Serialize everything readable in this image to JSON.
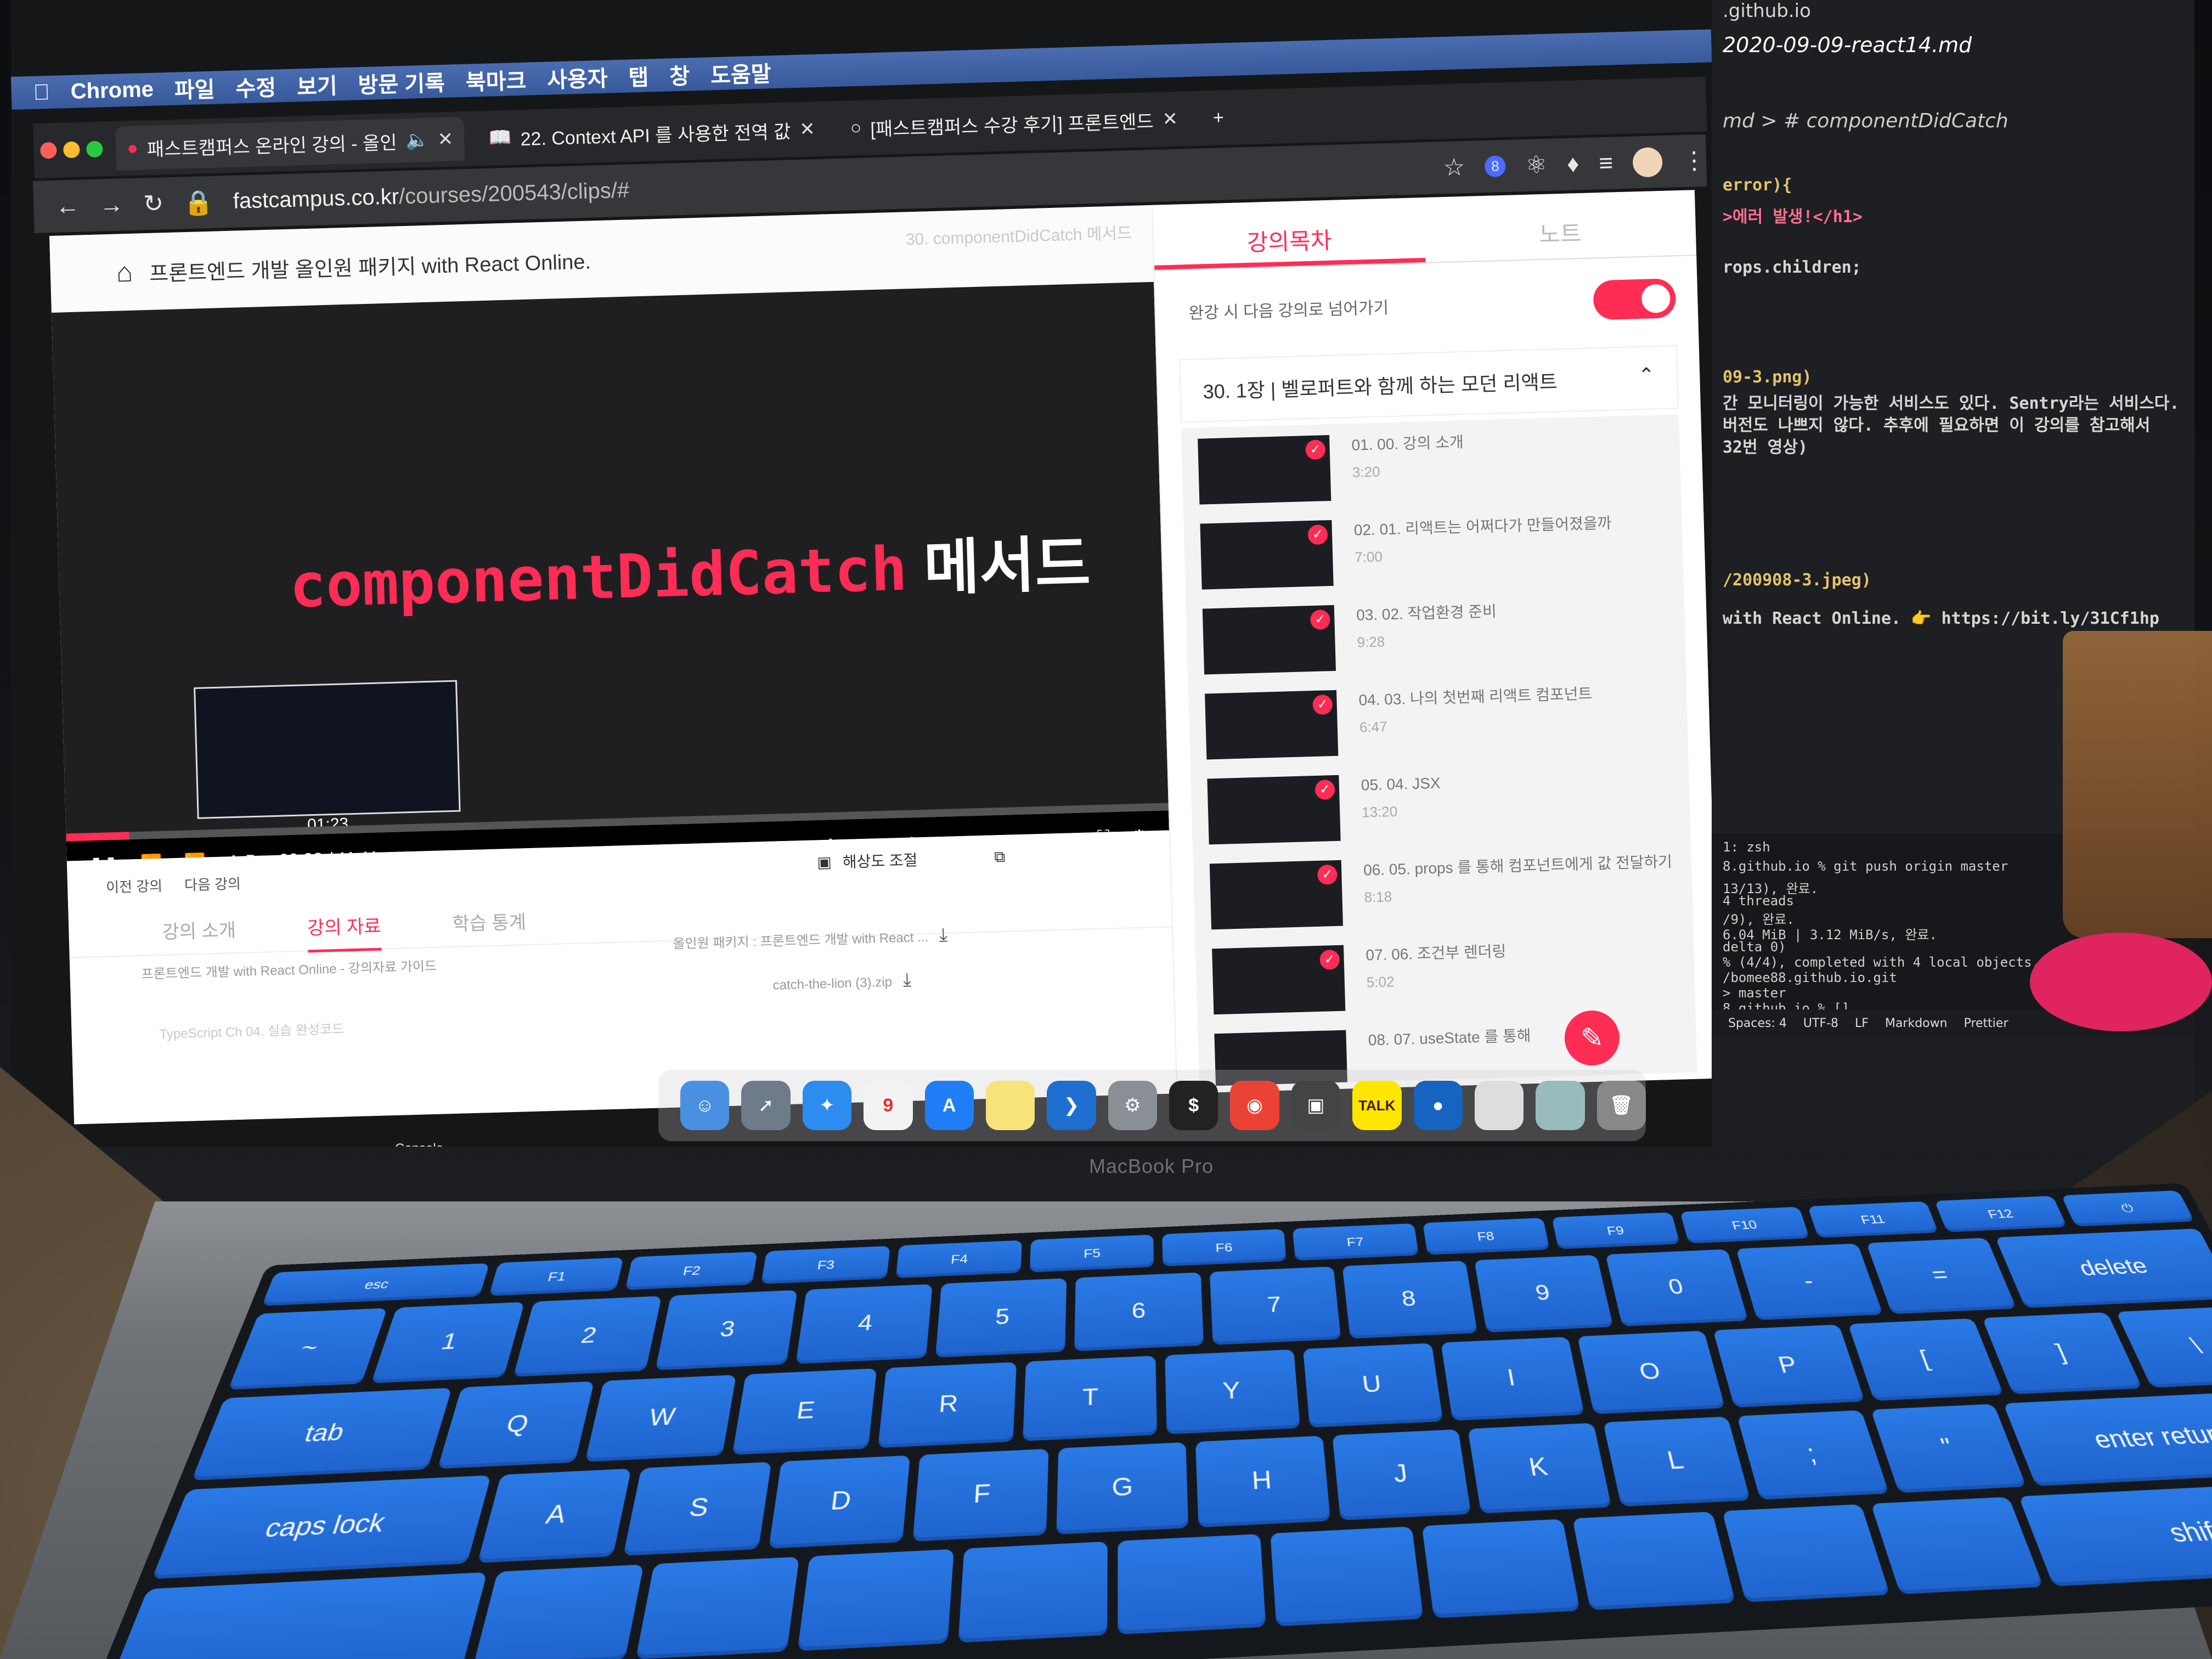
{
  "device": {
    "brand": "MacBook Pro"
  },
  "menubar": {
    "app": "Chrome",
    "items": [
      "파일",
      "수정",
      "보기",
      "방문 기록",
      "북마크",
      "사용자",
      "탭",
      "창",
      "도움말"
    ]
  },
  "browser": {
    "tabs": [
      {
        "label": "패스트캠퍼스 온라인 강의 - 올인"
      },
      {
        "label": "22. Context API 를 사용한 전역 값"
      },
      {
        "label": "[패스트캠퍼스 수강 후기] 프론트엔드"
      }
    ],
    "new_tab": "+",
    "url_domain": "fastcampus.co.kr",
    "url_path": "/courses/200543/clips/#",
    "extension_badge": "8"
  },
  "page": {
    "course_title": "프론트엔드 개발 올인원 패키지 with React Online.",
    "clip_title": "30. componentDidCatch 메서드",
    "video": {
      "code_text": "componentDidCatch",
      "ko_text": "메서드",
      "preview_time": "01:23",
      "ab_label": "A-B",
      "current_time": "00:38",
      "separator": "/",
      "total_time": "11:11",
      "speed": "1x",
      "progress": 0.057
    },
    "nav": {
      "prev": "이전 강의",
      "next": "다음 강의",
      "resolution": "해상도 조절"
    },
    "info_tabs": [
      "강의 소개",
      "강의 자료",
      "학습 통계"
    ],
    "files": [
      "프론트엔드 개발 with React Online - 강의자료 가이드",
      "올인원 패키지 : 프론트엔드 개발 with React ...",
      "catch-the-lion (3).zip",
      "TypeScript Ch 04. 실습 완성코드"
    ]
  },
  "sidebar": {
    "tabs": [
      "강의목차",
      "노트"
    ],
    "autoplay_label": "완강 시 다음 강의로 넘어가기",
    "chapter": "30. 1장 | 벨로퍼트와 함께 하는 모던 리액트",
    "lessons": [
      {
        "title": "01. 00. 강의 소개",
        "duration": "3:20",
        "thumb": "벨로퍼트와 함께하는 모던 리액트"
      },
      {
        "title": "02. 01. 리액트는 어쩌다가 만들어졌을까",
        "duration": "7:00",
        "thumb": "리액트는 어쩌다 만들어졌을까?"
      },
      {
        "title": "03. 02. 작업환경 준비",
        "duration": "9:28",
        "thumb": "작업환경 준비하기"
      },
      {
        "title": "04. 03. 나의 첫번째 리액트 컴포넌트",
        "duration": "6:47",
        "thumb": "나의 첫번째 리액트 컴포넌트"
      },
      {
        "title": "05. 04. JSX",
        "duration": "13:20",
        "thumb": "JSX 의 기본 규칙 알아보기"
      },
      {
        "title": "06. 05. props 를 통해 컴포넌트에게 값 전달하기",
        "duration": "8:18",
        "thumb": "props 를 통해 컴포넌트에게 값 전달하기"
      },
      {
        "title": "07. 06. 조건부 렌더링",
        "duration": "5:02",
        "thumb": "조건부 렌더링"
      },
      {
        "title": "08. 07. useState 를 통해",
        "duration": "",
        "thumb": ""
      }
    ]
  },
  "vscode": {
    "tab_title": "2020-09-09-react14.md",
    "url_fragment": ".github.io",
    "breadcrumb": "md > # componentDidCatch",
    "code": [
      "error){",
      ">에러 발생!</h1>",
      "rops.children;",
      "09-3.png)",
      "간 모니터링이 가능한 서비스도 있다. Sentry라는 서비스다.",
      "버전도 나쁘지 않다. 추후에 필요하면 이 강의를 참고해서",
      "32번 영상)",
      "/200908-3.jpeg)",
      "with React Online. 👉 https://bit.ly/31Cf1hp"
    ],
    "terminal": [
      "1: zsh",
      "8.github.io % git push origin master",
      "13/13), 완료.",
      "4 threads",
      "/9), 완료.",
      "6.04 MiB | 3.12 MiB/s, 완료.",
      "delta 0)",
      "% (4/4), completed with 4 local objects.",
      "/bomee88.github.io.git",
      "> master",
      "8.github.io % []"
    ],
    "status": [
      "Spaces: 4",
      "UTF-8",
      "LF",
      "Markdown",
      "Prettier"
    ]
  },
  "dock": {
    "console_label": "Console",
    "calendar_day": "9",
    "talk_label": "TALK"
  },
  "keyboard": {
    "fn_row": [
      "esc",
      "F1",
      "F2",
      "F3",
      "F4",
      "F5",
      "F6",
      "F7",
      "F8",
      "F9",
      "F10",
      "F11",
      "F12"
    ],
    "number_row": [
      "~",
      "1",
      "2",
      "3",
      "4",
      "5",
      "6",
      "7",
      "8",
      "9",
      "0",
      "-",
      "=",
      "delete"
    ],
    "top_row": [
      "tab",
      "Q",
      "W",
      "E",
      "R",
      "T",
      "Y",
      "U",
      "I",
      "O",
      "P",
      "[",
      "]",
      "\\"
    ],
    "home_row": [
      "caps lock",
      "A",
      "S",
      "D",
      "F",
      "G",
      "H",
      "J",
      "K",
      "L",
      ";",
      "\"",
      "enter return"
    ],
    "bottom_row": [
      "shift"
    ]
  },
  "colors": {
    "accent": "#ff2d55",
    "keyboard_blue": "#1f63cd",
    "coaster": "#e0245f"
  }
}
